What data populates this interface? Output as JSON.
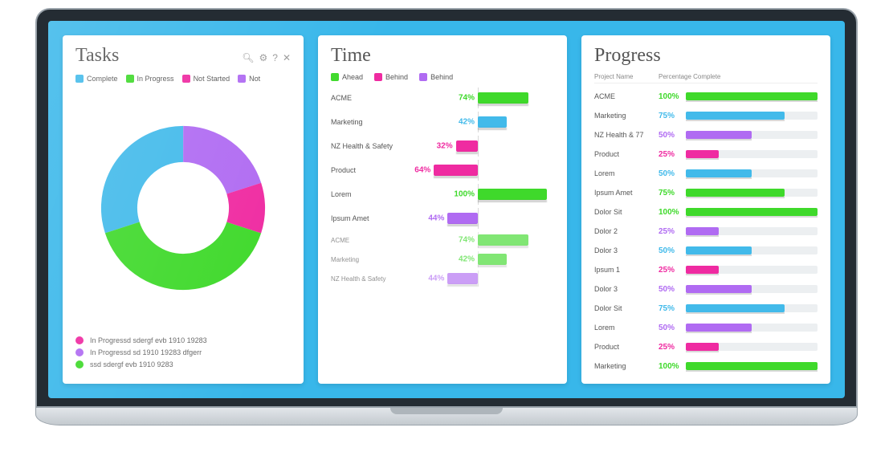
{
  "colors": {
    "blue": "#42baea",
    "green": "#3fd92b",
    "pink": "#ef2ba1",
    "purple": "#b06bf2"
  },
  "tasks": {
    "title": "Tasks",
    "legend": [
      {
        "label": "Complete",
        "color": "blue"
      },
      {
        "label": "In Progress",
        "color": "green"
      },
      {
        "label": "Not Started",
        "color": "pink"
      },
      {
        "label": "Not",
        "color": "purple"
      }
    ],
    "footnotes": [
      {
        "color": "pink",
        "text": "In Progressd sdergf  evb  1910   19283"
      },
      {
        "color": "purple",
        "text": "In Progressd sd 1910   19283 dfgerr"
      },
      {
        "color": "green",
        "text": "ssd sdergf  evb 1910 9283"
      }
    ]
  },
  "time": {
    "title": "Time",
    "legend": [
      {
        "label": "Ahead",
        "color": "green"
      },
      {
        "label": "Behind",
        "color": "pink"
      },
      {
        "label": "Behind",
        "color": "purple"
      }
    ],
    "rows": [
      {
        "label": "ACME",
        "value": 74,
        "dir": "right",
        "color": "green"
      },
      {
        "label": "Marketing",
        "value": 42,
        "dir": "right",
        "color": "blue"
      },
      {
        "label": "NZ Health & Safety",
        "value": 32,
        "dir": "left",
        "color": "pink"
      },
      {
        "label": "Product",
        "value": 64,
        "dir": "left",
        "color": "pink"
      },
      {
        "label": "Lorem",
        "value": 100,
        "dir": "right",
        "color": "green"
      },
      {
        "label": "Ipsum Amet",
        "value": 44,
        "dir": "left",
        "color": "purple"
      }
    ],
    "rows_faded": [
      {
        "label": "ACME",
        "value": 74,
        "dir": "right",
        "color": "green"
      },
      {
        "label": "Marketing",
        "value": 42,
        "dir": "right",
        "color": "green"
      },
      {
        "label": "NZ Health & Safety",
        "value": 44,
        "dir": "left",
        "color": "purple"
      }
    ]
  },
  "progress": {
    "title": "Progress",
    "columns": [
      "Project  Name",
      "Percentage Complete"
    ],
    "rows": [
      {
        "name": "ACME",
        "pct": 100,
        "color": "green"
      },
      {
        "name": "Marketing",
        "pct": 75,
        "color": "blue"
      },
      {
        "name": "NZ Health & 77",
        "pct": 50,
        "color": "purple"
      },
      {
        "name": "Product",
        "pct": 25,
        "color": "pink"
      },
      {
        "name": "Lorem",
        "pct": 50,
        "color": "blue"
      },
      {
        "name": "Ipsum Amet",
        "pct": 75,
        "color": "green"
      },
      {
        "name": "Dolor Sit",
        "pct": 100,
        "color": "green"
      },
      {
        "name": "Dolor 2",
        "pct": 25,
        "color": "purple"
      },
      {
        "name": "Dolor 3",
        "pct": 50,
        "color": "blue"
      },
      {
        "name": "Ipsum 1",
        "pct": 25,
        "color": "pink"
      },
      {
        "name": "Dolor 3",
        "pct": 50,
        "color": "purple"
      },
      {
        "name": "Dolor Sit",
        "pct": 75,
        "color": "blue"
      },
      {
        "name": "Lorem",
        "pct": 50,
        "color": "purple"
      },
      {
        "name": "Product",
        "pct": 25,
        "color": "pink"
      },
      {
        "name": "Marketing",
        "pct": 100,
        "color": "green"
      }
    ]
  },
  "chart_data": [
    {
      "type": "pie",
      "title": "Tasks",
      "series": [
        {
          "name": "Complete",
          "value": 30,
          "color": "#42baea"
        },
        {
          "name": "In Progress",
          "value": 40,
          "color": "#3fd92b"
        },
        {
          "name": "Not Started",
          "value": 10,
          "color": "#ef2ba1"
        },
        {
          "name": "Not",
          "value": 20,
          "color": "#b06bf2"
        }
      ],
      "donut": true
    },
    {
      "type": "bar",
      "title": "Time",
      "orientation": "horizontal-diverging",
      "legend": [
        "Ahead",
        "Behind",
        "Behind"
      ],
      "categories": [
        "ACME",
        "Marketing",
        "NZ Health & Safety",
        "Product",
        "Lorem",
        "Ipsum Amet",
        "ACME",
        "Marketing",
        "NZ Health & Safety"
      ],
      "values": [
        74,
        42,
        -32,
        -64,
        100,
        -44,
        74,
        42,
        -44
      ],
      "colors": [
        "#3fd92b",
        "#42baea",
        "#ef2ba1",
        "#ef2ba1",
        "#3fd92b",
        "#b06bf2",
        "#3fd92b",
        "#3fd92b",
        "#b06bf2"
      ],
      "xlim": [
        -100,
        100
      ]
    },
    {
      "type": "bar",
      "title": "Progress",
      "orientation": "horizontal",
      "xlabel": "Percentage Complete",
      "categories": [
        "ACME",
        "Marketing",
        "NZ Health & 77",
        "Product",
        "Lorem",
        "Ipsum Amet",
        "Dolor Sit",
        "Dolor 2",
        "Dolor 3",
        "Ipsum 1",
        "Dolor 3",
        "Dolor Sit",
        "Lorem",
        "Product",
        "Marketing"
      ],
      "values": [
        100,
        75,
        50,
        25,
        50,
        75,
        100,
        25,
        50,
        25,
        50,
        75,
        50,
        25,
        100
      ],
      "colors": [
        "#3fd92b",
        "#42baea",
        "#b06bf2",
        "#ef2ba1",
        "#42baea",
        "#3fd92b",
        "#3fd92b",
        "#b06bf2",
        "#42baea",
        "#ef2ba1",
        "#b06bf2",
        "#42baea",
        "#b06bf2",
        "#ef2ba1",
        "#3fd92b"
      ],
      "xlim": [
        0,
        100
      ]
    }
  ]
}
